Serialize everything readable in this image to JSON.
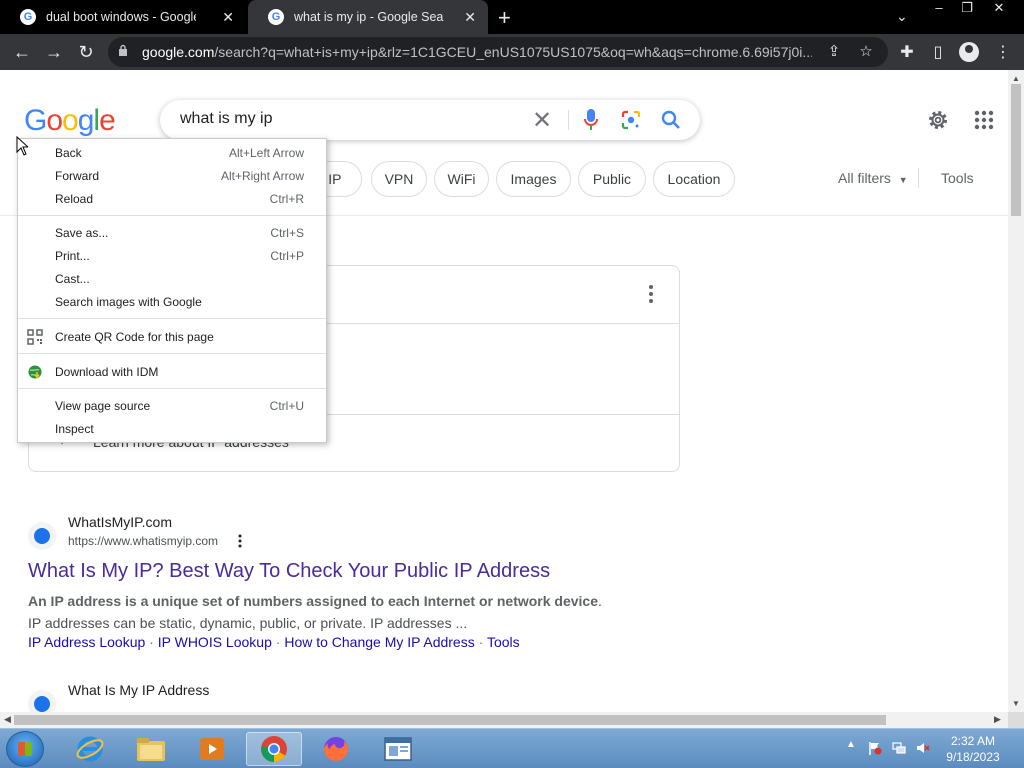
{
  "tabs": [
    {
      "title": "dual boot windows - Google Search",
      "active": false
    },
    {
      "title": "what is my ip - Google Search",
      "active": true
    }
  ],
  "omnibox": {
    "host": "google.com",
    "path": "/search?q=what+is+my+ip&rlz=1C1GCEU_enUS1075US1075&oq=wh&aqs=chrome.6.69i57j0i..."
  },
  "search": {
    "query": "what is my ip"
  },
  "filter_chips": [
    "e IP",
    "VPN",
    "WiFi",
    "Images",
    "Public",
    "Location"
  ],
  "filters_right": {
    "all_filters": "All filters",
    "tools": "Tools"
  },
  "card": {
    "learn_more": "Learn more about IP addresses"
  },
  "results": [
    {
      "site": "WhatIsMyIP.com",
      "url": "https://www.whatismyip.com",
      "title": "What Is My IP? Best Way To Check Your Public IP Address",
      "snippet_bold": "An IP address is a unique set of numbers assigned to each Internet or network device",
      "snippet_rest": ". IP addresses can be static, dynamic, public, or private. IP addresses ...",
      "links": [
        "IP Address Lookup",
        "IP WHOIS Lookup",
        "How to Change My IP Address",
        "Tools"
      ]
    },
    {
      "site": "What Is My IP Address"
    }
  ],
  "context_menu": {
    "items": [
      {
        "label": "Back",
        "shortcut": "Alt+Left Arrow"
      },
      {
        "label": "Forward",
        "shortcut": "Alt+Right Arrow"
      },
      {
        "label": "Reload",
        "shortcut": "Ctrl+R"
      },
      {
        "label": "Save as...",
        "shortcut": "Ctrl+S"
      },
      {
        "label": "Print...",
        "shortcut": "Ctrl+P"
      },
      {
        "label": "Cast...",
        "shortcut": ""
      },
      {
        "label": "Search images with Google",
        "shortcut": ""
      },
      {
        "label": "Create QR Code for this page",
        "shortcut": "",
        "icon": "qr-code-icon"
      },
      {
        "label": "Download with IDM",
        "shortcut": "",
        "icon": "idm-globe-icon"
      },
      {
        "label": "View page source",
        "shortcut": "Ctrl+U"
      },
      {
        "label": "Inspect",
        "shortcut": ""
      }
    ]
  },
  "taskbar": {
    "apps": [
      "internet-explorer-icon",
      "file-explorer-icon",
      "media-player-icon",
      "chrome-icon",
      "firefox-icon",
      "window-app-icon"
    ],
    "time": "2:32 AM",
    "date": "9/18/2023"
  },
  "colors": {
    "tabbar_bg": "#000000",
    "toolbar_bg": "#35363a",
    "visited_link": "#4b2a9b",
    "link": "#1a0dab",
    "google_blue": "#4285f4"
  }
}
